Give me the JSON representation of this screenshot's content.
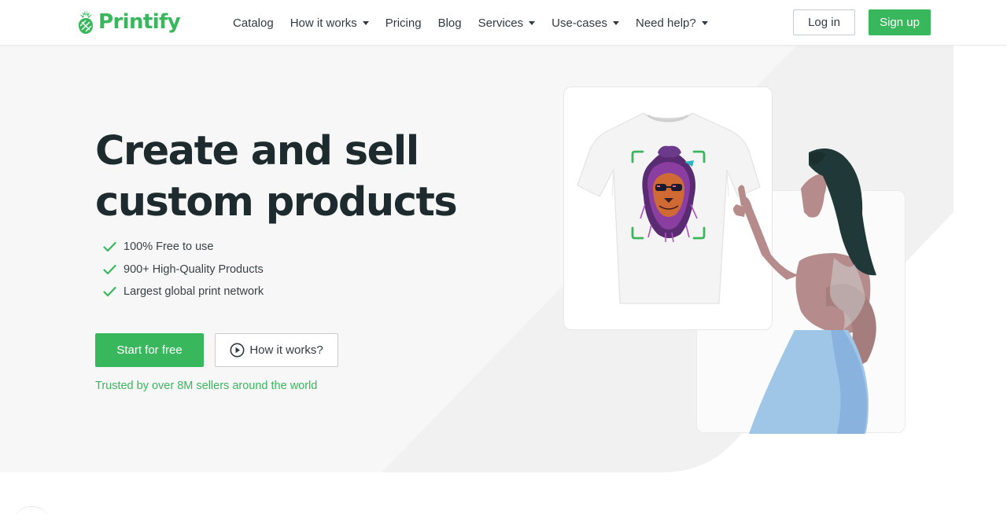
{
  "brand": {
    "name": "Printify",
    "color": "#39b75d"
  },
  "nav": {
    "items": [
      {
        "label": "Catalog",
        "dropdown": false
      },
      {
        "label": "How it works",
        "dropdown": true
      },
      {
        "label": "Pricing",
        "dropdown": false
      },
      {
        "label": "Blog",
        "dropdown": false
      },
      {
        "label": "Services",
        "dropdown": true
      },
      {
        "label": "Use-cases",
        "dropdown": true
      },
      {
        "label": "Need help?",
        "dropdown": true
      }
    ],
    "login_label": "Log in",
    "signup_label": "Sign up"
  },
  "hero": {
    "headline_line1": "Create and sell",
    "headline_line2": "custom products",
    "features": [
      "100% Free to use",
      "900+ High-Quality Products",
      "Largest global print network"
    ],
    "start_label": "Start for free",
    "how_label": "How it works?",
    "trusted_text": "Trusted by over 8M sellers around the world"
  },
  "icons": {
    "check": "check-icon",
    "play": "play-circle-icon",
    "caret": "chevron-down-icon"
  }
}
